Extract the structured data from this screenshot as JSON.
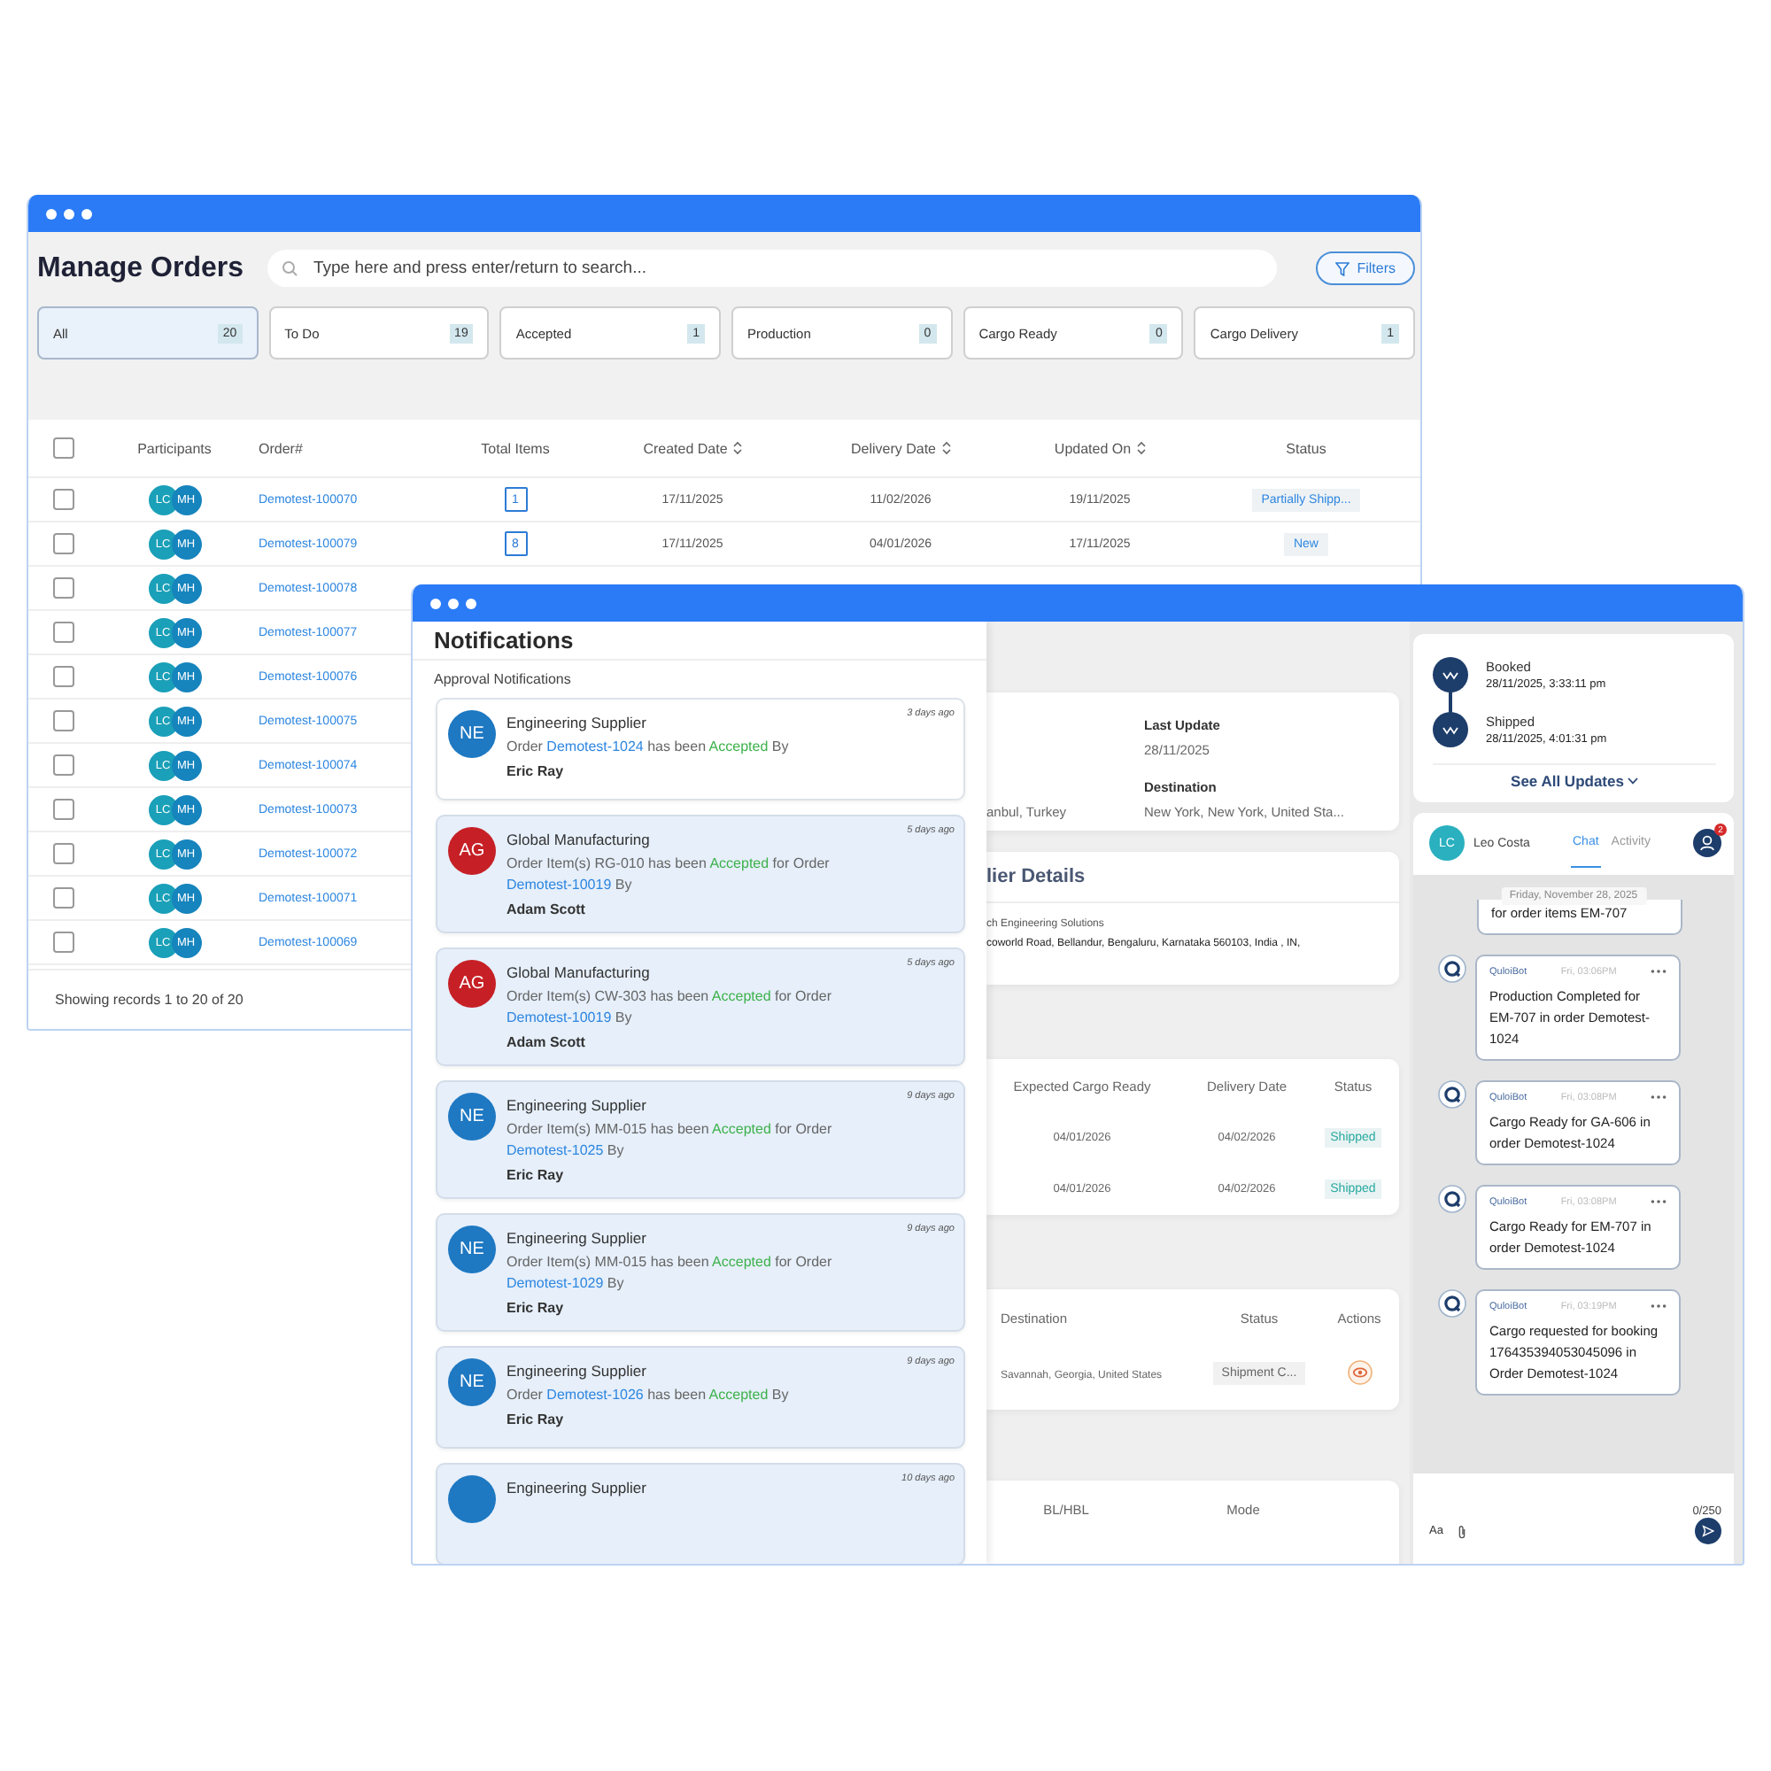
{
  "orders_window": {
    "title": "Manage Orders",
    "search": {
      "placeholder": "Type here and press enter/return to search..."
    },
    "filters_button": "Filters",
    "status_tabs": [
      {
        "label": "All",
        "count": "20",
        "selected": true
      },
      {
        "label": "To Do",
        "count": "19",
        "selected": false
      },
      {
        "label": "Accepted",
        "count": "1",
        "selected": false
      },
      {
        "label": "Production",
        "count": "0",
        "selected": false
      },
      {
        "label": "Cargo Ready",
        "count": "0",
        "selected": false
      },
      {
        "label": "Cargo Delivery",
        "count": "1",
        "selected": false
      }
    ],
    "table": {
      "select_all_checked": false,
      "columns": [
        {
          "label": "Participants",
          "sortable": false
        },
        {
          "label": "Order#",
          "sortable": false
        },
        {
          "label": "Total Items",
          "sortable": false
        },
        {
          "label": "Created Date",
          "sortable": true
        },
        {
          "label": "Delivery Date",
          "sortable": true
        },
        {
          "label": "Updated On",
          "sortable": true
        },
        {
          "label": "Status",
          "sortable": false
        }
      ],
      "rows": [
        {
          "checked": false,
          "participants": [
            "LC",
            "MH"
          ],
          "order": "Demotest-100070",
          "total_items": "1",
          "created": "17/11/2025",
          "delivery": "11/02/2026",
          "updated": "19/11/2025",
          "status": "Partially Shipp..."
        },
        {
          "checked": false,
          "participants": [
            "LC",
            "MH"
          ],
          "order": "Demotest-100079",
          "total_items": "8",
          "created": "17/11/2025",
          "delivery": "04/01/2026",
          "updated": "17/11/2025",
          "status": "New"
        },
        {
          "checked": false,
          "participants": [
            "LC",
            "MH"
          ],
          "order": "Demotest-100078"
        },
        {
          "checked": false,
          "participants": [
            "LC",
            "MH"
          ],
          "order": "Demotest-100077"
        },
        {
          "checked": false,
          "participants": [
            "LC",
            "MH"
          ],
          "order": "Demotest-100076"
        },
        {
          "checked": false,
          "participants": [
            "LC",
            "MH"
          ],
          "order": "Demotest-100075"
        },
        {
          "checked": false,
          "participants": [
            "LC",
            "MH"
          ],
          "order": "Demotest-100074"
        },
        {
          "checked": false,
          "participants": [
            "LC",
            "MH"
          ],
          "order": "Demotest-100073"
        },
        {
          "checked": false,
          "participants": [
            "LC",
            "MH"
          ],
          "order": "Demotest-100072"
        },
        {
          "checked": false,
          "participants": [
            "LC",
            "MH"
          ],
          "order": "Demotest-100071"
        },
        {
          "checked": false,
          "participants": [
            "LC",
            "MH"
          ],
          "order": "Demotest-100069"
        }
      ]
    },
    "footer": "Showing records 1 to 20 of 20"
  },
  "details_window": {
    "notifications": {
      "title": "Notifications",
      "section": "Approval Notifications",
      "items": [
        {
          "initials": "NE",
          "color": "#1e78c2",
          "sender": "Engineering Supplier",
          "time": "3 days ago",
          "unread": false,
          "message": [
            {
              "kind": "text",
              "text": "Order "
            },
            {
              "kind": "link",
              "text": "Demotest-1024"
            },
            {
              "kind": "text",
              "text": " has been "
            },
            {
              "kind": "status",
              "text": "Accepted"
            },
            {
              "kind": "text",
              "text": " By"
            }
          ],
          "by": "Eric Ray"
        },
        {
          "initials": "AG",
          "color": "#c62026",
          "sender": "Global Manufacturing",
          "time": "5 days ago",
          "unread": true,
          "message": [
            {
              "kind": "text",
              "text": "Order Item(s) RG-010 has been "
            },
            {
              "kind": "status",
              "text": "Accepted"
            },
            {
              "kind": "text",
              "text": " for Order "
            },
            {
              "kind": "link",
              "text": "Demotest-10019"
            },
            {
              "kind": "text",
              "text": " By"
            }
          ],
          "by": "Adam Scott"
        },
        {
          "initials": "AG",
          "color": "#c62026",
          "sender": "Global Manufacturing",
          "time": "5 days ago",
          "unread": true,
          "message": [
            {
              "kind": "text",
              "text": "Order Item(s) CW-303 has been "
            },
            {
              "kind": "status",
              "text": "Accepted"
            },
            {
              "kind": "text",
              "text": " for Order "
            },
            {
              "kind": "link",
              "text": "Demotest-10019"
            },
            {
              "kind": "text",
              "text": " By"
            }
          ],
          "by": "Adam Scott"
        },
        {
          "initials": "NE",
          "color": "#1e78c2",
          "sender": "Engineering Supplier",
          "time": "9 days ago",
          "unread": true,
          "message": [
            {
              "kind": "text",
              "text": "Order Item(s) MM-015 has been "
            },
            {
              "kind": "status",
              "text": "Accepted"
            },
            {
              "kind": "text",
              "text": " for Order "
            },
            {
              "kind": "link",
              "text": "Demotest-1025"
            },
            {
              "kind": "text",
              "text": " By"
            }
          ],
          "by": "Eric Ray"
        },
        {
          "initials": "NE",
          "color": "#1e78c2",
          "sender": "Engineering Supplier",
          "time": "9 days ago",
          "unread": true,
          "message": [
            {
              "kind": "text",
              "text": "Order Item(s) MM-015 has been "
            },
            {
              "kind": "status",
              "text": "Accepted"
            },
            {
              "kind": "text",
              "text": " for Order "
            },
            {
              "kind": "link",
              "text": "Demotest-1029"
            },
            {
              "kind": "text",
              "text": " By"
            }
          ],
          "by": "Eric Ray"
        },
        {
          "initials": "NE",
          "color": "#1e78c2",
          "sender": "Engineering Supplier",
          "time": "9 days ago",
          "unread": true,
          "message": [
            {
              "kind": "text",
              "text": "Order "
            },
            {
              "kind": "link",
              "text": "Demotest-1026"
            },
            {
              "kind": "text",
              "text": " has been "
            },
            {
              "kind": "status",
              "text": "Accepted"
            },
            {
              "kind": "text",
              "text": " By"
            }
          ],
          "by": "Eric Ray"
        },
        {
          "color": "#1e78c2",
          "sender": "Engineering Supplier",
          "time": "10 days ago",
          "unread": true
        }
      ]
    },
    "shipment_info": {
      "origin": "anbul, Turkey",
      "last_update_label": "Last Update",
      "last_update": "28/11/2025",
      "destination_label": "Destination",
      "destination": "New York, New York, United Sta..."
    },
    "supplier": {
      "heading": "lier Details",
      "name": "ch Engineering Solutions",
      "address": "coworld Road, Bellandur, Bengaluru, Karnataka 560103, India , IN,"
    },
    "items_table": {
      "columns": [
        "Expected Cargo Ready",
        "Delivery Date",
        "Status"
      ],
      "rows": [
        {
          "cargo_ready": "04/01/2026",
          "delivery": "04/02/2026",
          "status": "Shipped"
        },
        {
          "cargo_ready": "04/01/2026",
          "delivery": "04/02/2026",
          "status": "Shipped"
        }
      ]
    },
    "shipments_table": {
      "columns": [
        "Destination",
        "Status",
        "Actions"
      ],
      "rows": [
        {
          "destination": "Savannah, Georgia, United States",
          "status": "Shipment C..."
        }
      ]
    },
    "bl_table": {
      "columns": [
        "BL/HBL",
        "Mode"
      ]
    },
    "timeline": {
      "events": [
        {
          "label": "Booked",
          "time": "28/11/2025, 3:33:11 pm"
        },
        {
          "label": "Shipped",
          "time": "28/11/2025, 4:01:31 pm"
        }
      ],
      "see_all": "See All Updates"
    },
    "chat": {
      "avatar": "LC",
      "user": "Leo Costa",
      "tabs": [
        {
          "label": "Chat",
          "selected": true
        },
        {
          "label": "Activity",
          "selected": false
        }
      ],
      "participants_badge": "2",
      "date": "Friday, November 28, 2025",
      "partial_message": "for order items EM-707",
      "messages": [
        {
          "sender": "QuloiBot",
          "time": "Fri, 03:06PM",
          "text": "Production Completed for EM-707 in order Demotest-1024"
        },
        {
          "sender": "QuloiBot",
          "time": "Fri, 03:08PM",
          "text": "Cargo Ready for GA-606 in order Demotest-1024"
        },
        {
          "sender": "QuloiBot",
          "time": "Fri, 03:08PM",
          "text": "Cargo Ready for EM-707 in order Demotest-1024"
        },
        {
          "sender": "QuloiBot",
          "time": "Fri, 03:19PM",
          "text": "Cargo requested for booking 176435394053045096 in Order Demotest-1024"
        }
      ],
      "counter": "0/250",
      "format_label": "Aa"
    }
  }
}
